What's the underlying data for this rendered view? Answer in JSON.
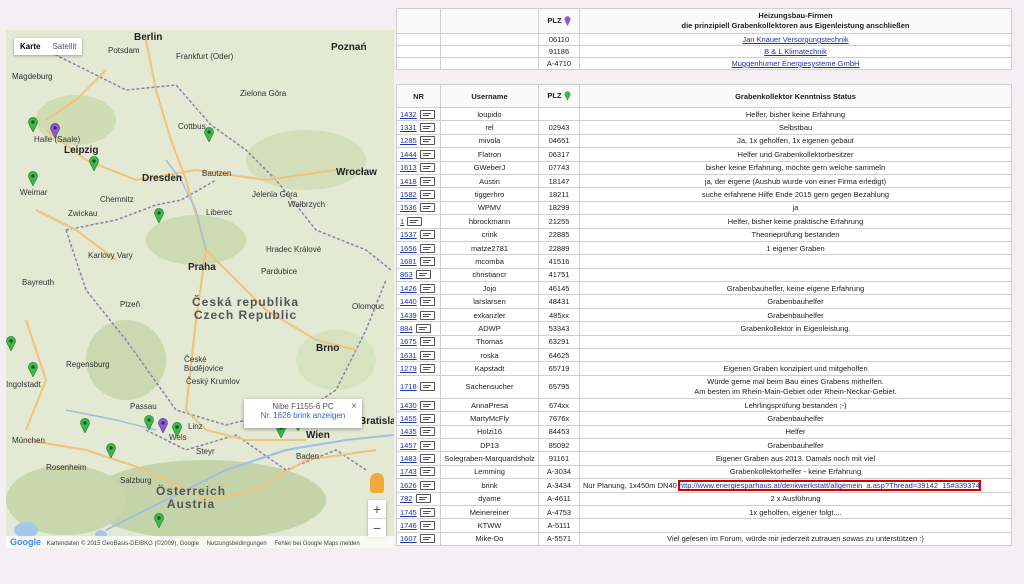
{
  "map": {
    "type_buttons": [
      "Karte",
      "Satellit"
    ],
    "cities": [
      "Berlin",
      "Potsdam",
      "Frankfurt (Oder)",
      "Poznań",
      "Magdeburg",
      "Zielona Góra",
      "Halle (Saale)",
      "Leipzig",
      "Cottbus",
      "Dresden",
      "Bautzen",
      "Wrocław",
      "Weimar",
      "Chemnitz",
      "Zwickau",
      "Jelenia Góra",
      "Liberec",
      "Wałbrzych",
      "Hradec Králové",
      "Praha",
      "Karlovy Vary",
      "Pardubice",
      "Bayreuth",
      "Plzeň",
      "Olomouc",
      "Brno",
      "Regensburg",
      "České Budějovice",
      "Český Krumlov",
      "Ingolstadt",
      "Passau",
      "Linz",
      "Wels",
      "Wien",
      "München",
      "Steyr",
      "Rosenheim",
      "Baden",
      "Salzburg",
      "Bratislava",
      "Nürnberg",
      "Ústí"
    ],
    "country_label": [
      "Česká republika",
      "Czech Republic"
    ],
    "country_label2": [
      "Österreich",
      "Austria"
    ],
    "info_window": {
      "title": "Nibe F1155-6 PC",
      "link": "Nr. 1626 brink anzeigen",
      "close": "×"
    },
    "zoom_in": "+",
    "zoom_out": "−",
    "footer": {
      "logo": "Google",
      "attribution": "Kartendaten © 2015 GeoBasis-DE/BKG (©2009), Google",
      "terms": "Nutzungsbedingungen",
      "report": "Fehler bei Google Maps melden"
    },
    "pin_colors": {
      "green": "#3bb84a",
      "purple": "#8a5bd1"
    }
  },
  "firms": {
    "header_plz": "PLZ",
    "header_title_1": "Heizungsbau-Firmen",
    "header_title_2": "die prinzipiell Grabenkollektoren aus Eigenleistung anschließen",
    "rows": [
      {
        "plz": "06110",
        "name": "Jan Knauer Versorgungstechnik"
      },
      {
        "plz": "91186",
        "name": "B & L Klimatechnik"
      },
      {
        "plz": "A-4710",
        "name": "Muggenhumer Energiesysteme GmbH"
      }
    ]
  },
  "members": {
    "headers": {
      "nr": "NR",
      "user": "Username",
      "plz": "PLZ",
      "status": "Grabenkollektor Kenntniss Status"
    },
    "rows": [
      {
        "nr": "1432",
        "user": "loupido",
        "plz": "",
        "status": "Helfer, bisher keine Erfahrung"
      },
      {
        "nr": "1331",
        "user": "rel",
        "plz": "02943",
        "status": "Selbstbau"
      },
      {
        "nr": "1285",
        "user": "mivola",
        "plz": "04651",
        "status": "Ja, 1x geholfen, 1x eigenen gebaut"
      },
      {
        "nr": "1444",
        "user": "Flatron",
        "plz": "06317",
        "status": "Helfer und Grabenkollektorbesitzer"
      },
      {
        "nr": "1613",
        "user": "GWeberJ",
        "plz": "07743",
        "status": "bisher keine Erfahrung, möchte gern welche sammeln"
      },
      {
        "nr": "1418",
        "user": "Austin",
        "plz": "18147",
        "status": "ja, der eigene (Aushub wurde von einer Firma erledigt)"
      },
      {
        "nr": "1582",
        "user": "tiggerhro",
        "plz": "18211",
        "status": "suche erfahrene Hilfe Ende 2015 gern gegen Bezahlung"
      },
      {
        "nr": "1536",
        "user": "WPMV",
        "plz": "18299",
        "status": "ja"
      },
      {
        "nr": "1",
        "user": "hbrockmann",
        "plz": "21255",
        "status": "Helfer, bisher keine praktische Erfahrung"
      },
      {
        "nr": "1537",
        "user": "crink",
        "plz": "22885",
        "status": "Theorieprüfung bestanden"
      },
      {
        "nr": "1656",
        "user": "matze2781",
        "plz": "22889",
        "status": "1 eigener Graben"
      },
      {
        "nr": "1681",
        "user": "mcomba",
        "plz": "41516",
        "status": ""
      },
      {
        "nr": "863",
        "user": "christiancr",
        "plz": "41751",
        "status": ""
      },
      {
        "nr": "1426",
        "user": "Jojo",
        "plz": "46145",
        "status": "Grabenbauhelfer, keine eigene Erfahrung"
      },
      {
        "nr": "1440",
        "user": "larslarsen",
        "plz": "48431",
        "status": "Grabenbauhelfer"
      },
      {
        "nr": "1439",
        "user": "exkanzler",
        "plz": "485xx",
        "status": "Grabenbauhelfer"
      },
      {
        "nr": "884",
        "user": "ADWP",
        "plz": "53343",
        "status": "Grabenkollektor in Eigenleistung."
      },
      {
        "nr": "1675",
        "user": "Thomas",
        "plz": "63291",
        "status": ""
      },
      {
        "nr": "1631",
        "user": "roska",
        "plz": "64625",
        "status": ""
      },
      {
        "nr": "1279",
        "user": "Kapstadt",
        "plz": "65719",
        "status": "Eigenen Graben konzipiert und mitgeholfen"
      },
      {
        "nr": "1718",
        "user": "Sachensucher",
        "plz": "65795",
        "status": "Würde gerne mal beim Bau eines Grabens mithelfen.",
        "status2": "Am besten im Rhein-Main-Gebiet oder Rhein-Neckar-Gebiet."
      },
      {
        "nr": "1430",
        "user": "AnnaPresa",
        "plz": "674xx",
        "status": "Lehrlingsprüfung bestanden ;-)"
      },
      {
        "nr": "1455",
        "user": "MartyMcFly",
        "plz": "7676x",
        "status": "Grabenbauhelfer"
      },
      {
        "nr": "1435",
        "user": "Holzi16",
        "plz": "84453",
        "status": "Helfer"
      },
      {
        "nr": "1457",
        "user": "DP13",
        "plz": "85092",
        "status": "Grabenbauhelfer"
      },
      {
        "nr": "1483",
        "user": "Solegraben-Marquardsholz",
        "plz": "91161",
        "status": "Eigener Graben aus 2013. Damals noch mit viel"
      },
      {
        "nr": "1743",
        "user": "Lemming",
        "plz": "A-3034",
        "status": "Grabenkollektorhelfer - keine Erfahrung"
      },
      {
        "nr": "1626",
        "user": "brink",
        "plz": "A-3434",
        "status": "Nur Planung, 1x450m DN40",
        "link": "http://www.energiesparhaus.at/denkwerkstatt/allgemein_a.asp?Thread=39142_15#339374"
      },
      {
        "nr": "782",
        "user": "dyame",
        "plz": "A-4611",
        "status": "2 x Ausführung"
      },
      {
        "nr": "1745",
        "user": "Meinereiner",
        "plz": "A-4753",
        "status": "1x geholfen, eigener folgt...."
      },
      {
        "nr": "1746",
        "user": "KTWW",
        "plz": "A-5111",
        "status": ""
      },
      {
        "nr": "1607",
        "user": "Mike-Do",
        "plz": "A-5571",
        "status": "Viel gelesen im Forum, würde mir jederzeit zutrauen sowas zu unterstützen :)"
      }
    ]
  }
}
